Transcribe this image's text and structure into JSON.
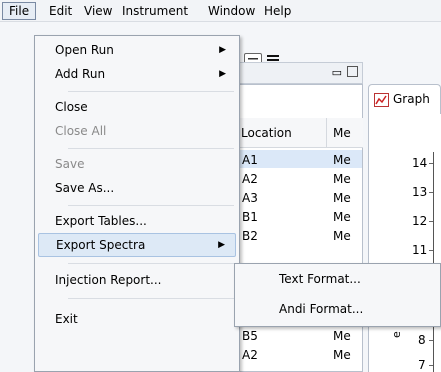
{
  "menubar": {
    "items": [
      "File",
      "Edit",
      "View",
      "Instrument",
      "Window",
      "Help"
    ]
  },
  "file_menu": {
    "open_run": "Open Run",
    "add_run": "Add Run",
    "close": "Close",
    "close_all": "Close All",
    "save": "Save",
    "save_as": "Save As...",
    "export_tables": "Export Tables...",
    "export_spectra": "Export Spectra",
    "injection_report": "Injection Report...",
    "exit": "Exit"
  },
  "export_spectra_submenu": {
    "text_format": "Text Format...",
    "andi_format": "Andi Format..."
  },
  "table": {
    "columns": [
      "Location",
      "Me"
    ],
    "rows": [
      [
        "A1",
        "Me"
      ],
      [
        "A2",
        "Me"
      ],
      [
        "A3",
        "Me"
      ],
      [
        "B1",
        "Me"
      ],
      [
        "B2",
        "Me"
      ],
      [
        "B5",
        "Me"
      ],
      [
        "A2",
        "Me"
      ]
    ]
  },
  "graph": {
    "tab_label": "Graph",
    "y_ticks": [
      "14",
      "13",
      "12",
      "11",
      "8",
      "7"
    ],
    "y_axis_label_fragment": "e (mAU"
  },
  "colors": {
    "menu_highlight": "#dde9f6",
    "selected_row": "#dbe8f8"
  }
}
